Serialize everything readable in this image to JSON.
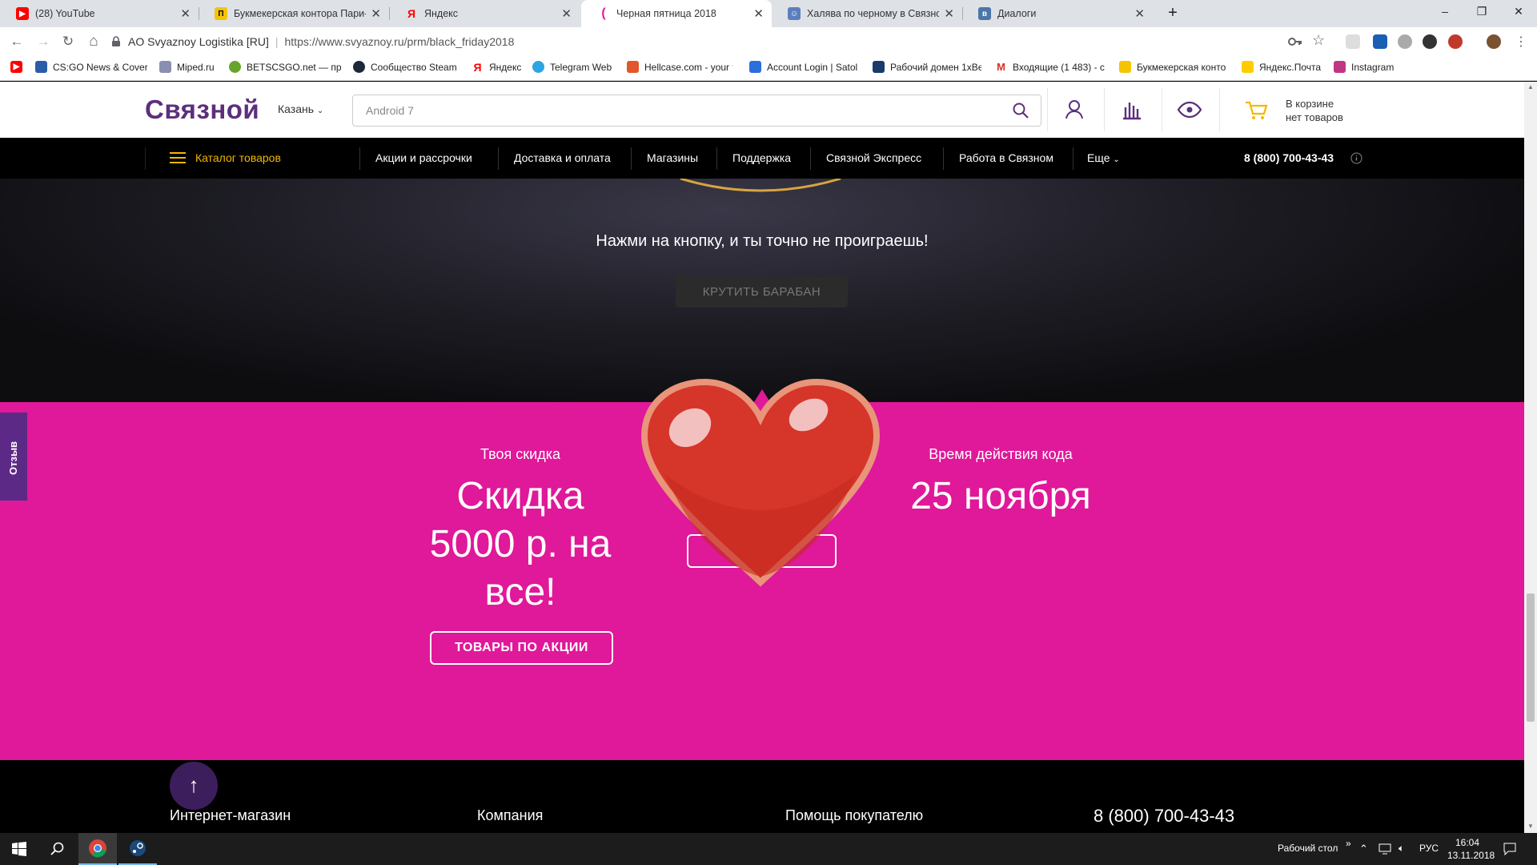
{
  "browser": {
    "tabs": [
      {
        "title": "(28) YouTube",
        "icon": "youtube-icon",
        "color": "#ff0000"
      },
      {
        "title": "Букмекерская контора Пари-М",
        "icon": "parim-icon",
        "color": "#f5c400"
      },
      {
        "title": "Яндекс",
        "icon": "yandex-icon",
        "color": "#ff0000"
      },
      {
        "title": "Черная пятница 2018",
        "icon": "svyaznoy-icon",
        "color": "#e0189a",
        "active": true
      },
      {
        "title": "Халява по черному в Связном",
        "icon": "forum-icon",
        "color": "#5b7fbd"
      },
      {
        "title": "Диалоги",
        "icon": "vk-icon",
        "color": "#4a76a8"
      }
    ],
    "new_tab": "+",
    "window_controls": {
      "minimize": "–",
      "maximize": "❐",
      "close": "✕"
    },
    "back": "←",
    "forward": "→",
    "reload": "↻",
    "home": "⌂",
    "cert": "AO Svyaznoy Logistika [RU]",
    "url": "https://www.svyaznoy.ru/prm/black_friday2018",
    "bookmarks": [
      {
        "label": "",
        "icon": "youtube-icon",
        "color": "#ff0000"
      },
      {
        "label": "CS:GO News & Cover",
        "icon": "csgo-icon",
        "color": "#2a5da8"
      },
      {
        "label": "Miped.ru",
        "icon": "miped-icon",
        "color": "#8a8fb0"
      },
      {
        "label": "BETSCSGO.net — пр",
        "icon": "betscsgo-icon",
        "color": "#67a52a"
      },
      {
        "label": "Сообщество Steam",
        "icon": "steam-icon",
        "color": "#1b2838"
      },
      {
        "label": "Яндекс",
        "icon": "yandex-icon",
        "color": "#ff0000"
      },
      {
        "label": "Telegram Web",
        "icon": "telegram-icon",
        "color": "#2ca5e0"
      },
      {
        "label": "Hellcase.com - your f",
        "icon": "hellcase-icon",
        "color": "#e2572b"
      },
      {
        "label": "Account Login | Satol",
        "icon": "satol-icon",
        "color": "#2a6fdb"
      },
      {
        "label": "Рабочий домен 1xBe",
        "icon": "1xbet-icon",
        "color": "#1a3a6b"
      },
      {
        "label": "Входящие (1 483) - с",
        "icon": "gmail-icon",
        "color": "#d93025"
      },
      {
        "label": "Букмекерская конто",
        "icon": "parim-icon",
        "color": "#f5c400"
      },
      {
        "label": "Яндекс.Почта",
        "icon": "yandex-mail-icon",
        "color": "#ffcc00"
      },
      {
        "label": "Instagram",
        "icon": "instagram-icon",
        "color": "#c13584"
      }
    ]
  },
  "site": {
    "logo": "Связной",
    "city": "Казань",
    "search_placeholder": "Android 7",
    "cart_line1": "В корзине",
    "cart_line2": "нет товаров",
    "nav": {
      "catalog": "Каталог товаров",
      "items": [
        "Акции и рассрочки",
        "Доставка и оплата",
        "Магазины",
        "Поддержка",
        "Связной Экспресс",
        "Работа в Связном",
        "Еще"
      ],
      "phone": "8 (800) 700-43-43"
    },
    "hero": {
      "text": "Нажми на кнопку, и ты точно не проиграешь!",
      "button": "КРУТИТЬ БАРАБАН"
    },
    "promo": {
      "discount_label": "Твоя скидка",
      "discount_value_lines": [
        "Скидка",
        "5000 р. на",
        "все!"
      ],
      "products_button": "ТОВАРЫ ПО АКЦИИ",
      "validity_label": "Время действия кода",
      "validity_value": "25 ноября"
    },
    "feedback": "Отзыв",
    "footer": {
      "columns": [
        "Интернет-магазин",
        "Компания",
        "Помощь покупателю"
      ],
      "phone": "8 (800) 700-43-43"
    },
    "colors": {
      "brand": "#5c2f7d",
      "pink": "#e0189a",
      "catalog": "#f5b700"
    }
  },
  "taskbar": {
    "desktop_label": "Рабочий стол",
    "lang": "РУС",
    "time": "16:04",
    "date": "13.11.2018",
    "chevron": "»"
  }
}
